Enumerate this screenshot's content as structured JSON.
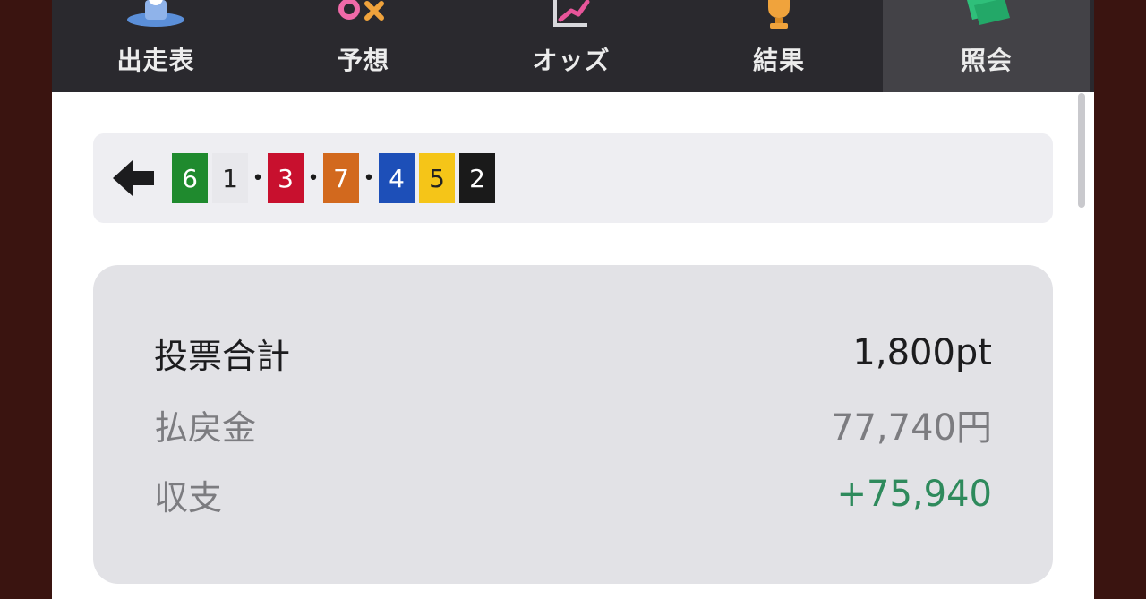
{
  "nav": {
    "tabs": [
      {
        "label": "出走表",
        "icon": "podium-icon"
      },
      {
        "label": "予想",
        "icon": "prediction-icon"
      },
      {
        "label": "オッズ",
        "icon": "odds-chart-icon"
      },
      {
        "label": "結果",
        "icon": "trophy-icon"
      },
      {
        "label": "照会",
        "icon": "ticket-icon"
      }
    ],
    "active_tab": "照会"
  },
  "combination": {
    "groups": [
      [
        {
          "num": "6",
          "bg": "#1f8a2e",
          "fg": "#ffffff"
        },
        {
          "num": "1",
          "bg": "#e8e8ec",
          "fg": "#222222"
        }
      ],
      [
        {
          "num": "3",
          "bg": "#c8102e",
          "fg": "#ffffff"
        }
      ],
      [
        {
          "num": "7",
          "bg": "#d2691e",
          "fg": "#ffffff"
        }
      ],
      [
        {
          "num": "4",
          "bg": "#1d4fb8",
          "fg": "#ffffff"
        },
        {
          "num": "5",
          "bg": "#f5c518",
          "fg": "#222222"
        },
        {
          "num": "2",
          "bg": "#1a1a1a",
          "fg": "#ffffff"
        }
      ]
    ],
    "separator": "•"
  },
  "summary": {
    "total_bet_label": "投票合計",
    "total_bet_value": "1,800pt",
    "payout_label": "払戻金",
    "payout_value": "77,740円",
    "balance_label": "収支",
    "balance_value": "+75,940"
  },
  "colors": {
    "navbar_bg": "#2a292e",
    "active_tab_bg": "#434247",
    "positive": "#2e8a5c"
  }
}
